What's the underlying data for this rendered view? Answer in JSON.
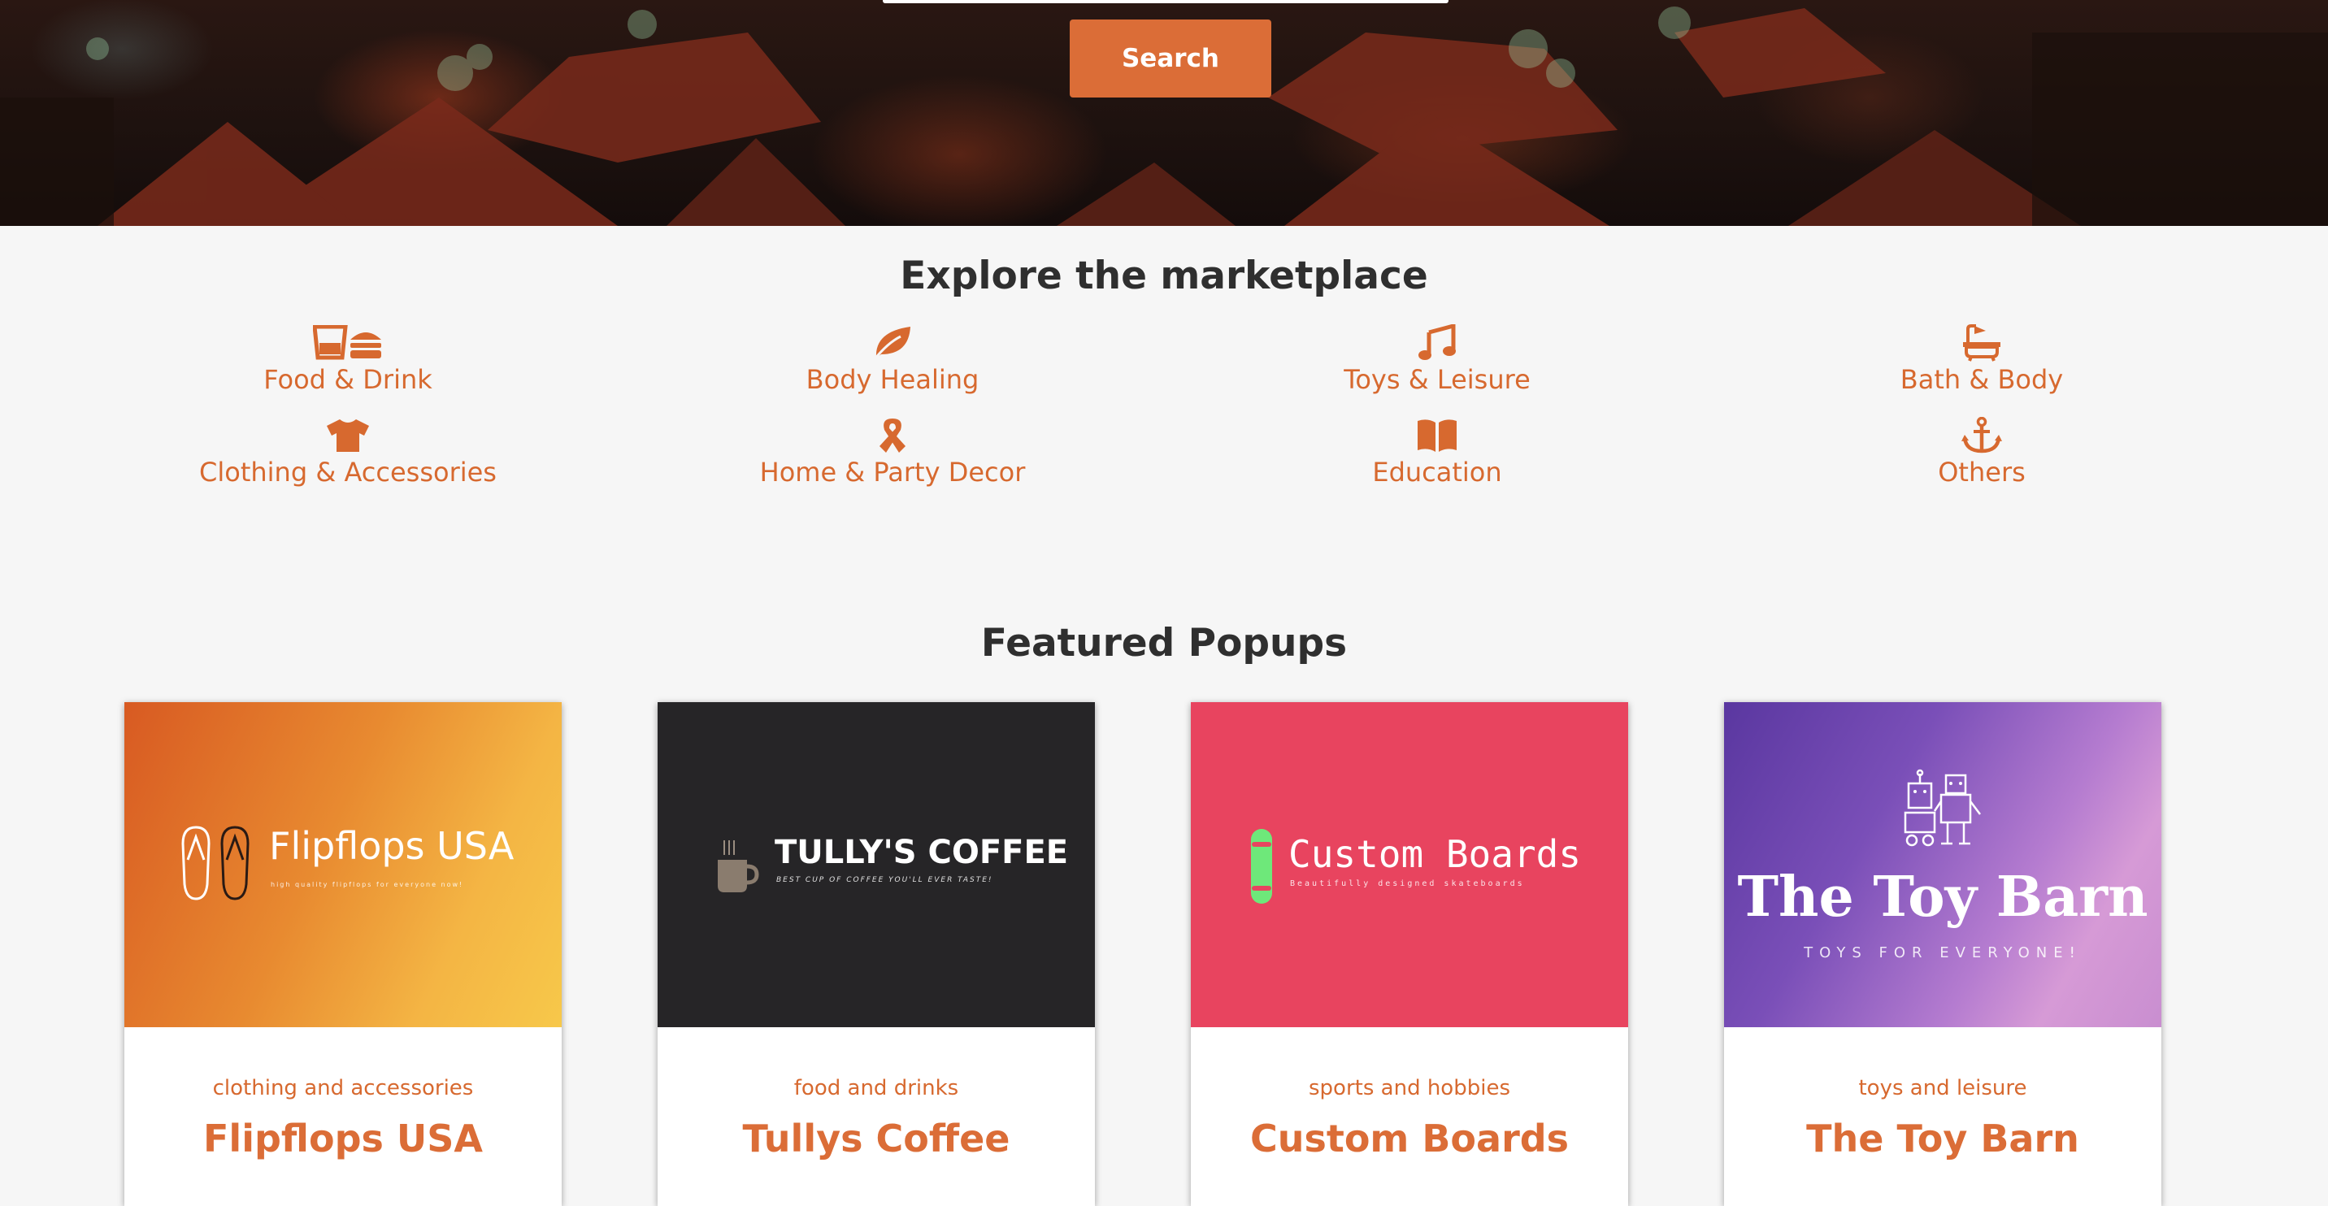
{
  "hero": {
    "search_button": "Search"
  },
  "explore": {
    "title": "Explore the marketplace",
    "categories": [
      {
        "label": "Food & Drink",
        "icon": "food-drink-icon"
      },
      {
        "label": "Body Healing",
        "icon": "leaf-icon"
      },
      {
        "label": "Toys & Leisure",
        "icon": "music-note-icon"
      },
      {
        "label": "Bath & Body",
        "icon": "bathtub-icon"
      },
      {
        "label": "Clothing & Accessories",
        "icon": "tshirt-icon"
      },
      {
        "label": "Home & Party Decor",
        "icon": "ribbon-icon"
      },
      {
        "label": "Education",
        "icon": "book-icon"
      },
      {
        "label": "Others",
        "icon": "anchor-icon"
      }
    ]
  },
  "featured": {
    "title": "Featured Popups",
    "cards": [
      {
        "category": "clothing and accessories",
        "name": "Flipflops USA",
        "logo_title": "Flipflops USA",
        "logo_tagline": "high quality flipflops for everyone now!"
      },
      {
        "category": "food and drinks",
        "name": "Tullys Coffee",
        "logo_title": "TULLY'S COFFEE",
        "logo_tagline": "BEST CUP OF COFFEE YOU'LL EVER TASTE!"
      },
      {
        "category": "sports and hobbies",
        "name": "Custom Boards",
        "logo_title": "Custom Boards",
        "logo_tagline": "Beautifully designed skateboards"
      },
      {
        "category": "toys and leisure",
        "name": "The Toy Barn",
        "logo_title": "The Toy Barn",
        "logo_tagline": "TOYS FOR EVERYONE!"
      }
    ]
  },
  "colors": {
    "accent": "#db6d37",
    "heading": "#2f2f2f",
    "background": "#f6f6f6"
  }
}
